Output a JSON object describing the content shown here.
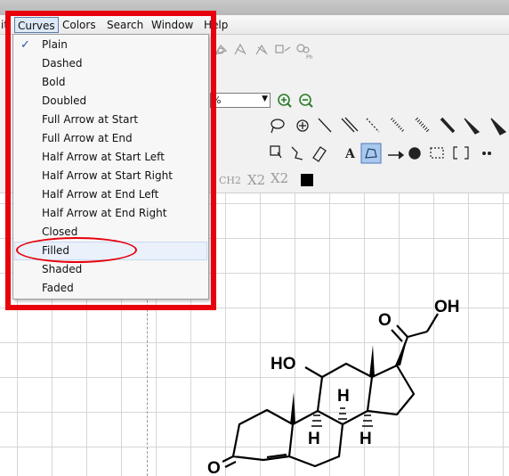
{
  "menubar": {
    "partial_left": "it",
    "items": [
      {
        "label": "Curves"
      },
      {
        "label": "Colors"
      },
      {
        "label": "Search"
      },
      {
        "label": "Window"
      },
      {
        "label": "Help"
      }
    ]
  },
  "curves_menu": {
    "items": [
      {
        "label": "Plain",
        "checked": true
      },
      {
        "label": "Dashed"
      },
      {
        "label": "Bold"
      },
      {
        "label": "Doubled"
      },
      {
        "label": "Full Arrow at Start"
      },
      {
        "label": "Full Arrow at End"
      },
      {
        "label": "Half Arrow at Start Left"
      },
      {
        "label": "Half Arrow at Start Right"
      },
      {
        "label": "Half Arrow at End Left"
      },
      {
        "label": "Half Arrow at End Right"
      },
      {
        "label": "Closed"
      },
      {
        "label": "Filled",
        "highlighted": true
      },
      {
        "label": "Shaded"
      },
      {
        "label": "Faded"
      }
    ]
  },
  "toolbar": {
    "zoom_value": "%",
    "ph_label": "Ph",
    "ch2_label": "CH2",
    "x2_sub_label": "X2",
    "x2_sup_label": "X2",
    "text_tool_label": "A"
  },
  "molecule": {
    "labels": {
      "ketone_o": "O",
      "hydroxymethyl": "OH",
      "ho_11": "HO",
      "h_8": "H",
      "h_9": "H",
      "h_14": "H",
      "o_3": "O"
    }
  },
  "colors": {
    "annotation_red": "#e8000c",
    "menu_highlight": "#eaf1fb"
  }
}
